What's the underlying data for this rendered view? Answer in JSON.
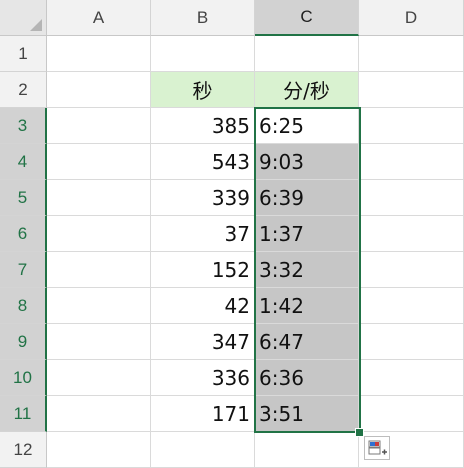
{
  "columns": [
    "A",
    "B",
    "C",
    "D"
  ],
  "rows": [
    "1",
    "2",
    "3",
    "4",
    "5",
    "6",
    "7",
    "8",
    "9",
    "10",
    "11",
    "12"
  ],
  "headers": {
    "b2": "秒",
    "c2": "分/秒"
  },
  "data": [
    {
      "seconds": "385",
      "time": "6:25"
    },
    {
      "seconds": "543",
      "time": "9:03"
    },
    {
      "seconds": "339",
      "time": "6:39"
    },
    {
      "seconds": "37",
      "time": "1:37"
    },
    {
      "seconds": "152",
      "time": "3:32"
    },
    {
      "seconds": "42",
      "time": "1:42"
    },
    {
      "seconds": "347",
      "time": "6:47"
    },
    {
      "seconds": "336",
      "time": "6:36"
    },
    {
      "seconds": "171",
      "time": "3:51"
    }
  ],
  "colors": {
    "accent": "#217346",
    "header_fill": "#d9f2d0",
    "selection_fill": "#c6c6c6"
  },
  "quick_analysis_icon": "quick-analysis-icon"
}
